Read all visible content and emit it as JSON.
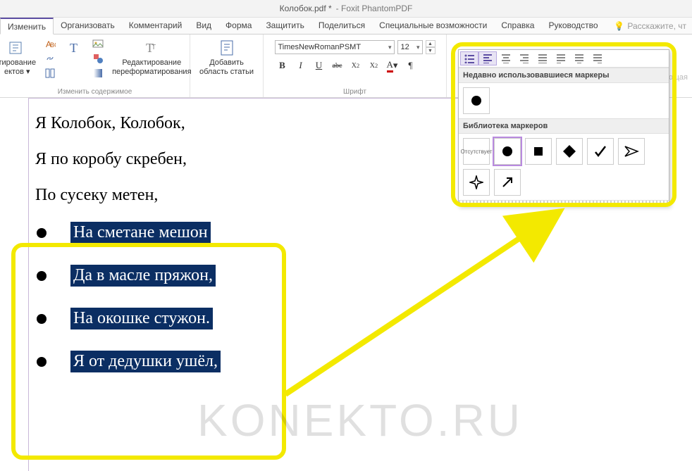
{
  "title": {
    "doc": "Колобок.pdf *",
    "app": "Foxit PhantomPDF"
  },
  "tabs": {
    "edit": "Изменить",
    "organize": "Организовать",
    "comment": "Комментарий",
    "view": "Вид",
    "form": "Форма",
    "protect": "Защитить",
    "share": "Поделиться",
    "accessibility": "Специальные возможности",
    "help": "Справка",
    "guide": "Руководство",
    "tellme": "Расскажите, чт"
  },
  "ribbon": {
    "contentGroup": "Изменить содержимое",
    "fontGroup": "Шрифт",
    "editObjectsL1": "тирование",
    "editObjectsL2": "ектов",
    "reformatL1": "Редактирование",
    "reformatL2": "переформатирования",
    "addArticleL1": "Добавить",
    "addArticleL2": "область статьи",
    "fontName": "TimesNewRomanPSMT",
    "fontSize": "12",
    "sideOpt1": "Обрезающая",
    "sideOpt2": ""
  },
  "popup": {
    "recent": "Недавно использовавшиеся маркеры",
    "library": "Библиотека маркеров",
    "none": "Отсутствует"
  },
  "doc": {
    "l1": "Я Колобок, Колобок,",
    "l2": "Я по коробу скребен,",
    "l3": "По сусеку метен,",
    "b1": "На сметане мешон",
    "b2": "Да в масле пряжон,",
    "b3": "На окошке стужон.",
    "b4": "Я от дедушки ушёл,"
  },
  "watermark": "KONEKTO.RU"
}
